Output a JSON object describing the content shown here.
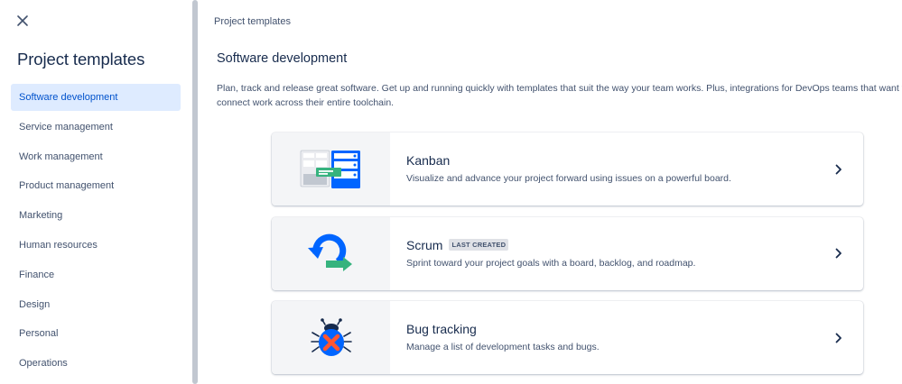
{
  "sidebar": {
    "title": "Project templates",
    "items": [
      {
        "label": "Software development",
        "active": true
      },
      {
        "label": "Service management",
        "active": false
      },
      {
        "label": "Work management",
        "active": false
      },
      {
        "label": "Product management",
        "active": false
      },
      {
        "label": "Marketing",
        "active": false
      },
      {
        "label": "Human resources",
        "active": false
      },
      {
        "label": "Finance",
        "active": false
      },
      {
        "label": "Design",
        "active": false
      },
      {
        "label": "Personal",
        "active": false
      },
      {
        "label": "Operations",
        "active": false
      }
    ]
  },
  "main": {
    "breadcrumb": "Project templates",
    "section_title": "Software development",
    "section_description": "Plan, track and release great software. Get up and running quickly with templates that suit the way your team works. Plus, integrations for DevOps teams that want to connect work across their entire toolchain.",
    "cards": [
      {
        "title": "Kanban",
        "badge": "",
        "description": "Visualize and advance your project forward using issues on a powerful board.",
        "icon": "kanban-board-illustration"
      },
      {
        "title": "Scrum",
        "badge": "LAST CREATED",
        "description": "Sprint toward your project goals with a board, backlog, and roadmap.",
        "icon": "scrum-cycle-illustration"
      },
      {
        "title": "Bug tracking",
        "badge": "",
        "description": "Manage a list of development tasks and bugs.",
        "icon": "bug-illustration"
      }
    ]
  },
  "colors": {
    "active_bg": "#deebff",
    "active_text": "#0052cc",
    "heading": "#172b4d",
    "body_text": "#42526e",
    "brand_blue": "#0065ff",
    "accent_green": "#36b37e"
  }
}
